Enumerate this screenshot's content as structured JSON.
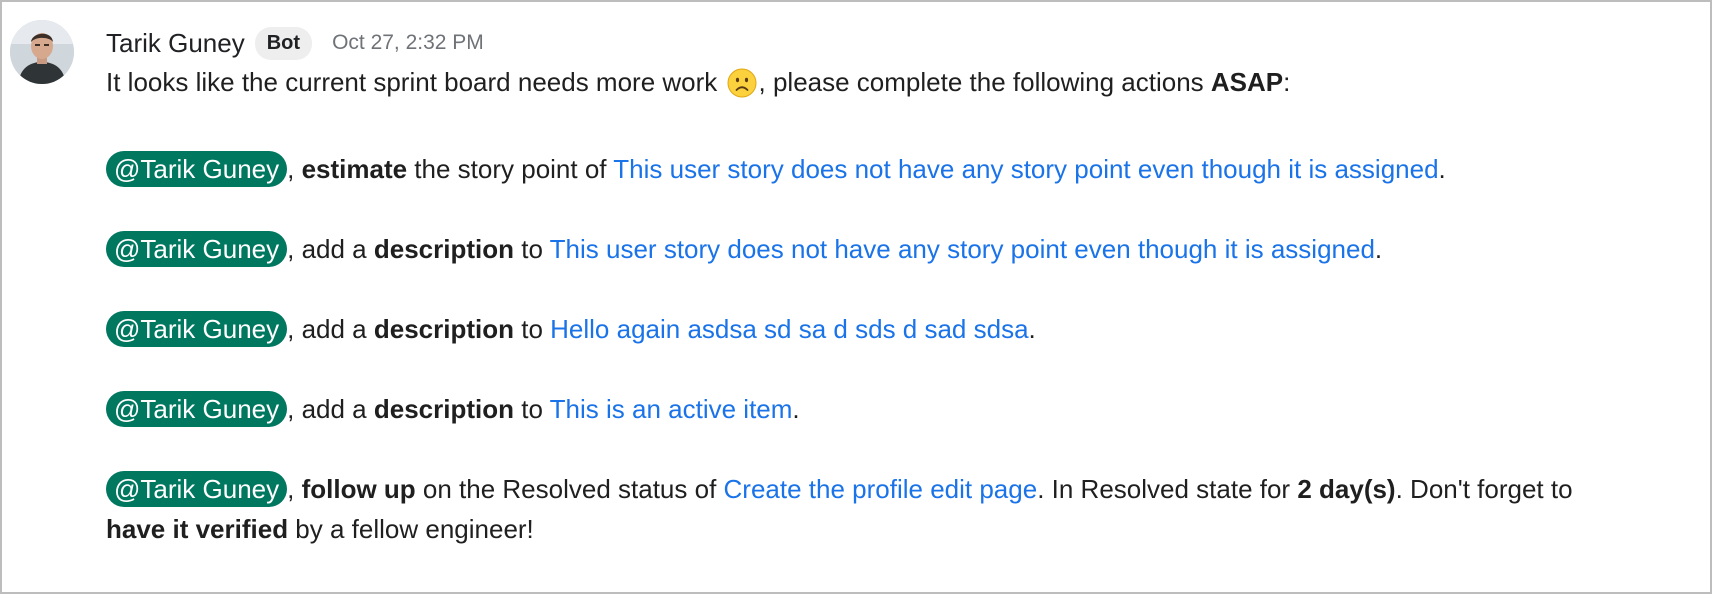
{
  "message": {
    "sender": "Tarik Guney",
    "badge": "Bot",
    "timestamp": "Oct 27, 2:32 PM",
    "intro": {
      "before_emoji": "It looks like the current sprint board needs more work ",
      "emoji": "frowning-face",
      "after_emoji": ", please complete the following actions ",
      "bold": "ASAP",
      "end": ":"
    },
    "actions": [
      {
        "mention": "@Tarik Guney",
        "pre": ", ",
        "bold": "estimate",
        "mid": " the story point of ",
        "link": "This user story does not have any story point even though it is assigned",
        "end": "."
      },
      {
        "mention": "@Tarik Guney",
        "pre": ", add a ",
        "bold": "description",
        "mid": " to ",
        "link": "This user story does not have any story point even though it is assigned",
        "end": "."
      },
      {
        "mention": "@Tarik Guney",
        "pre": ", add a ",
        "bold": "description",
        "mid": " to ",
        "link": "Hello again asdsa sd sa d sds d sad sdsa",
        "end": "."
      },
      {
        "mention": "@Tarik Guney",
        "pre": ", add a ",
        "bold": "description",
        "mid": " to ",
        "link": "This is an active item",
        "end": "."
      }
    ],
    "followup": {
      "mention": "@Tarik Guney",
      "pre": ", ",
      "bold": "follow up",
      "mid": " on the Resolved status of ",
      "link": "Create the profile edit page",
      "after_link": ". In Resolved state for ",
      "bold2": "2 day(s)",
      "after_bold2": ". Don't forget to",
      "bold3": "have it verified",
      "end": " by a fellow engineer!"
    }
  },
  "colors": {
    "mention_bg": "#00775f",
    "link": "#1a73e8",
    "badge_bg": "#eeeeee",
    "timestamp": "#6f7378"
  }
}
